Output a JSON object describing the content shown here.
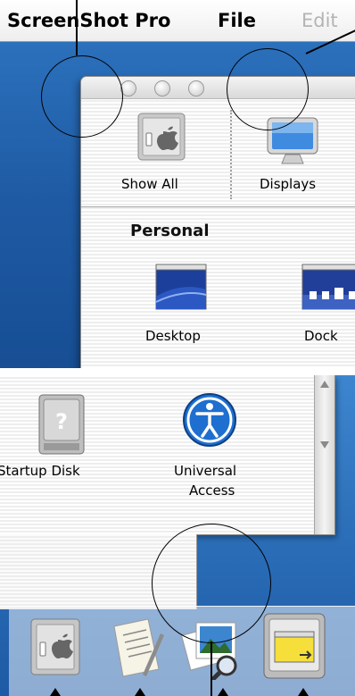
{
  "menubar": {
    "app_name": "ScreenShot Pro",
    "file_menu": "File",
    "edit_menu": "Edit"
  },
  "preferences_window": {
    "toolbar_items": [
      {
        "label": "Show All",
        "icon": "apple-switch-icon"
      },
      {
        "label": "Displays",
        "icon": "display-monitor-icon"
      }
    ],
    "section_title": "Personal",
    "section_items": [
      {
        "label": "Desktop",
        "icon": "desktop-pref-icon"
      },
      {
        "label": "Dock",
        "icon": "dock-pref-icon"
      }
    ],
    "bottom_items": [
      {
        "label": "Startup Disk",
        "icon": "hard-disk-icon"
      },
      {
        "label_line1": "Universal",
        "label_line2": "Access",
        "icon": "universal-access-icon"
      }
    ]
  },
  "dock": {
    "items": [
      {
        "name": "system-preferences",
        "icon": "apple-switch-icon"
      },
      {
        "name": "textedit",
        "icon": "textedit-icon"
      },
      {
        "name": "preview",
        "icon": "preview-icon"
      },
      {
        "name": "screenshot-pro",
        "icon": "screenshot-window-icon"
      }
    ]
  },
  "colors": {
    "desktop_blue": "#1f5ea7",
    "callout_stroke": "#000000"
  }
}
